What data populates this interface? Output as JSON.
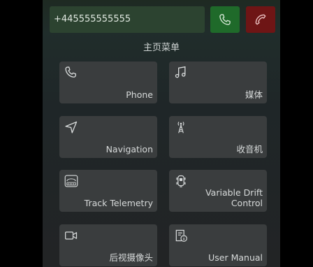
{
  "phone": {
    "number": "+445555555555",
    "accept_icon": "phone-call-icon",
    "reject_icon": "phone-hangup-icon"
  },
  "menu": {
    "title": "主页菜单",
    "tiles": [
      {
        "label": "Phone",
        "icon": "phone-icon"
      },
      {
        "label": "媒体",
        "icon": "music-note-icon"
      },
      {
        "label": "Navigation",
        "icon": "navigation-arrow-icon"
      },
      {
        "label": "收音机",
        "icon": "radio-tower-icon"
      },
      {
        "label": "Track Telemetry",
        "icon": "gauge-icon"
      },
      {
        "label": "Variable Drift Control",
        "icon": "drift-car-icon"
      },
      {
        "label": "后视摄像头",
        "icon": "camera-icon"
      },
      {
        "label": "User Manual",
        "icon": "manual-info-icon"
      }
    ]
  },
  "colors": {
    "accept": "#1f6a2a",
    "reject": "#6e1515",
    "tile": "#3a3d3e",
    "input": "#2c4330"
  }
}
